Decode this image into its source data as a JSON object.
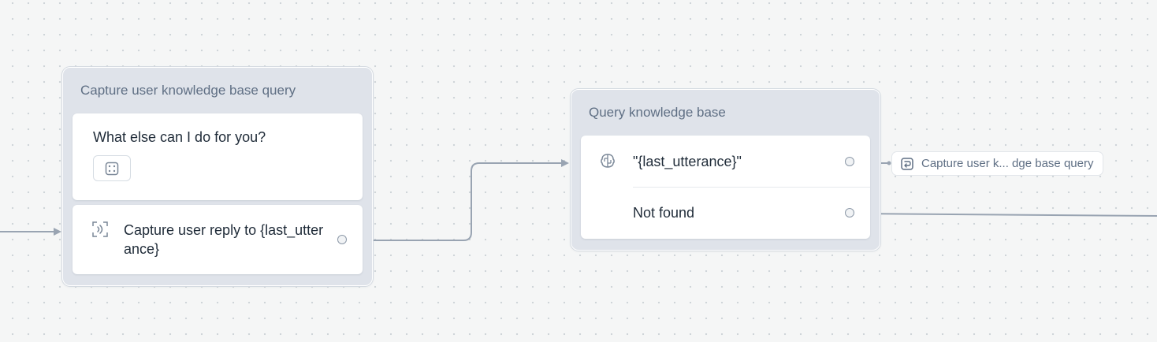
{
  "blocks": [
    {
      "title": "Capture user knowledge base query",
      "steps": {
        "message": "What else can I do for you?",
        "capture_label": "Capture user reply to {last_utterance}"
      }
    },
    {
      "title": "Query knowledge base",
      "steps": {
        "query": "\"{last_utterance}\"",
        "not_found": "Not found"
      }
    }
  ],
  "goto_chip": {
    "label": "Capture user k... dge base query"
  },
  "icons": {
    "variant": "dice-icon",
    "capture": "capture-icon",
    "knowledge": "brain-icon",
    "goto": "goto-block-icon"
  },
  "colors": {
    "canvas": "#f5f6f6",
    "block_bg": "#dfe3ea",
    "edge": "#99a4b2",
    "title_text": "#5f6f84"
  }
}
